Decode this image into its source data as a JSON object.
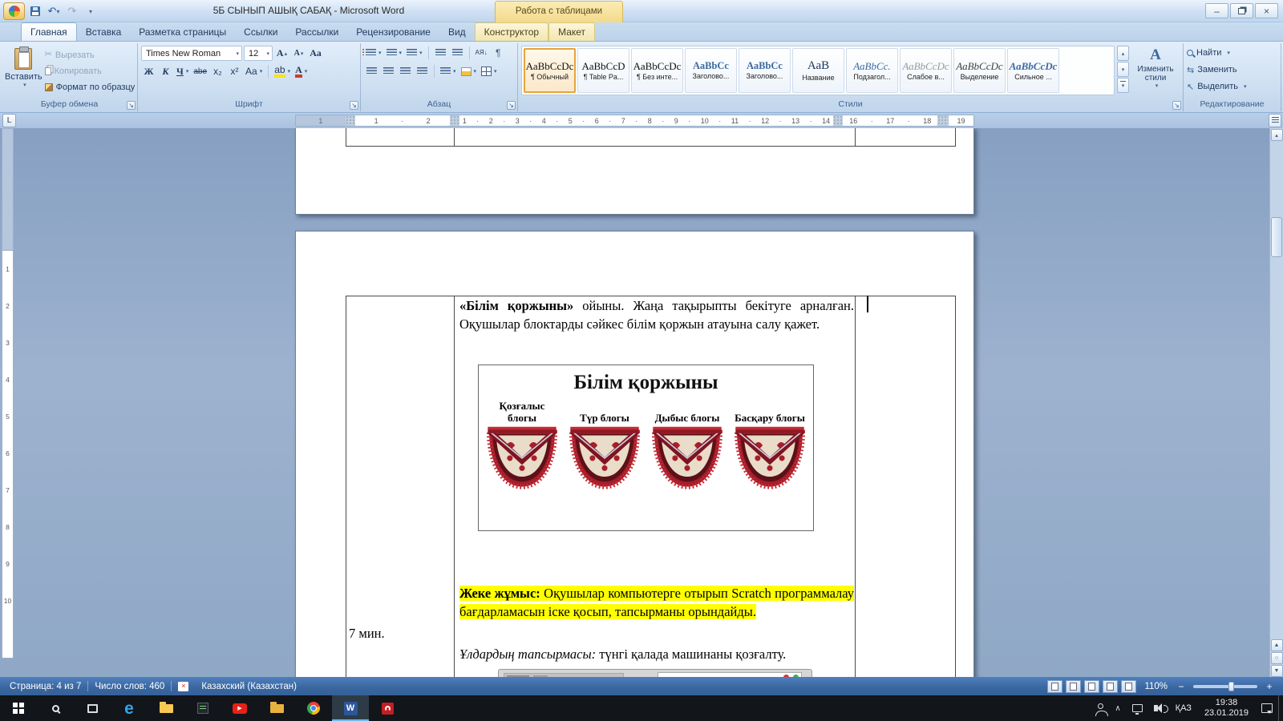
{
  "window": {
    "title": "5Б СЫНЫП АШЫҚ САБАҚ - Microsoft Word",
    "context_header": "Работа с таблицами"
  },
  "icons": {
    "dropdown": "▾",
    "undo": "↶",
    "redo": "↷",
    "scissors": "✂",
    "up": "▴",
    "down": "▾",
    "minimize": "–",
    "close": "×",
    "find_select": "↖",
    "swap": "⇆",
    "pilcrow": "¶",
    "sort": "АЯ↓",
    "prev_page": "▲",
    "browse": "○",
    "next_page": "▼",
    "chevron_up": "∧",
    "spell_x": "×"
  },
  "ribbon": {
    "tabs": [
      {
        "name": "tab-home",
        "label": "Главная",
        "cls": "active"
      },
      {
        "name": "tab-insert",
        "label": "Вставка",
        "cls": ""
      },
      {
        "name": "tab-page-layout",
        "label": "Разметка страницы",
        "cls": ""
      },
      {
        "name": "tab-references",
        "label": "Ссылки",
        "cls": ""
      },
      {
        "name": "tab-mailings",
        "label": "Рассылки",
        "cls": ""
      },
      {
        "name": "tab-review",
        "label": "Рецензирование",
        "cls": ""
      },
      {
        "name": "tab-view",
        "label": "Вид",
        "cls": ""
      },
      {
        "name": "tab-table-design",
        "label": "Конструктор",
        "cls": "ctx"
      },
      {
        "name": "tab-table-layout",
        "label": "Макет",
        "cls": "ctx"
      }
    ],
    "clipboard": {
      "label": "Буфер обмена",
      "paste": "Вставить",
      "cut": "Вырезать",
      "copy": "Копировать",
      "painter": "Формат по образцу"
    },
    "font": {
      "label": "Шрифт",
      "name": "Times New Roman",
      "size": "12",
      "bold": "Ж",
      "italic": "К",
      "underline": "Ч",
      "strike": "abe",
      "subscript": "x₂",
      "superscript": "x²",
      "case_btn": "Aa",
      "clear": "Аа",
      "grow": "А",
      "shrink": "А",
      "highlight": "ab",
      "color_btn": "А"
    },
    "paragraph": {
      "label": "Абзац"
    },
    "styles": {
      "label": "Стили",
      "change": "Изменить стили",
      "items": [
        {
          "name": "style-normal",
          "preview": "АаBbCcDc",
          "title": "¶ Обычный",
          "cls": "sel"
        },
        {
          "name": "style-table-paragraph",
          "preview": "АаBbCcD",
          "title": "¶ Table Pa...",
          "cls": ""
        },
        {
          "name": "style-no-spacing",
          "preview": "АаBbCcDc",
          "title": "¶ Без инте...",
          "cls": ""
        },
        {
          "name": "style-heading-1",
          "preview": "АаBbCс",
          "title": "Заголово...",
          "cls": "h1"
        },
        {
          "name": "style-heading-2",
          "preview": "АаBbCc",
          "title": "Заголово...",
          "cls": "h2"
        },
        {
          "name": "style-title",
          "preview": "АаВ",
          "title": "Название",
          "cls": "ttl"
        },
        {
          "name": "style-subtitle",
          "preview": "АаBbCс.",
          "title": "Подзагол...",
          "cls": "sub"
        },
        {
          "name": "style-subtle-emphasis",
          "preview": "АаBbCcDс",
          "title": "Слабое в...",
          "cls": "subtle"
        },
        {
          "name": "style-emphasis",
          "preview": "АаBbCcDс",
          "title": "Выделение",
          "cls": "emph"
        },
        {
          "name": "style-strong",
          "preview": "АаBbCcDс",
          "title": "Сильное ...",
          "cls": "strong"
        }
      ]
    },
    "editing": {
      "label": "Редактирование",
      "find": "Найти",
      "replace": "Заменить",
      "select": "Выделить"
    }
  },
  "ruler": {
    "left_margin": "1",
    "seg1": "1 · 2",
    "seg2": "1 · 2 · 3 · 4 · 5 · 6 · 7 · 8 · 9 · 10 · 11 · 12 · 13 · 14",
    "seg3": "16 · 17 · 18",
    "seg4": "19",
    "vertical": [
      "1",
      "2",
      "3",
      "4",
      "5",
      "6",
      "7",
      "8",
      "9",
      "10"
    ]
  },
  "doc": {
    "para1_bold": "«Білім қоржыны»",
    "para1_text": " ойыны. Жаңа тақырыпты бекітуге арналған. Оқушылар блоктарды сәйкес білім қоржын атауына салу қажет.",
    "figure_title": "Білім қоржыны",
    "pouches": [
      {
        "name": "pouch-motion-block",
        "label": "Қозғалыс блогы"
      },
      {
        "name": "pouch-looks-block",
        "label": "Түр блогы"
      },
      {
        "name": "pouch-sound-block",
        "label": "Дыбыс блогы"
      },
      {
        "name": "pouch-control-block",
        "label": "Басқару блогы"
      }
    ],
    "para2_bold": "Жеке жұмыс:",
    "para2_text": " Оқушылар компьютерге отырып Scratch программалау бағдарламасын іске қосып, тапсырманы орындайды.",
    "time_cell": "7 мин.",
    "para3_italic": "Ұлдардың тапсырмасы:",
    "para3_text": " түнгі қалада машинаны қозғалту."
  },
  "statusbar": {
    "page": "Страница: 4 из 7",
    "words": "Число слов: 460",
    "language": "Казахский (Казахстан)",
    "zoom": "110%"
  },
  "taskbar": {
    "icons": [
      {
        "name": "start-button",
        "cls": "tb-start",
        "glyph": ""
      },
      {
        "name": "search-icon",
        "cls": "tb-search",
        "glyph": ""
      },
      {
        "name": "task-view-icon",
        "cls": "tb-taskview",
        "glyph": ""
      },
      {
        "name": "edge-icon",
        "cls": "tb-edge",
        "glyph": "e"
      },
      {
        "name": "file-explorer-icon",
        "cls": "tb-explorer",
        "glyph": ""
      },
      {
        "name": "dark-app-icon",
        "cls": "tb-darkapp",
        "glyph": ""
      },
      {
        "name": "youtube-icon",
        "cls": "tb-youtube",
        "glyph": "▶"
      },
      {
        "name": "folder-icon",
        "cls": "tb-folder",
        "glyph": ""
      },
      {
        "name": "chrome-icon",
        "cls": "tb-chrome",
        "glyph": ""
      },
      {
        "name": "word-icon",
        "cls": "tb-word active",
        "glyph": "W"
      },
      {
        "name": "reader-app-icon",
        "cls": "tb-acrobat",
        "glyph": ""
      }
    ],
    "lang": "ҚАЗ",
    "time": "19:38",
    "date": "23.01.2019"
  }
}
